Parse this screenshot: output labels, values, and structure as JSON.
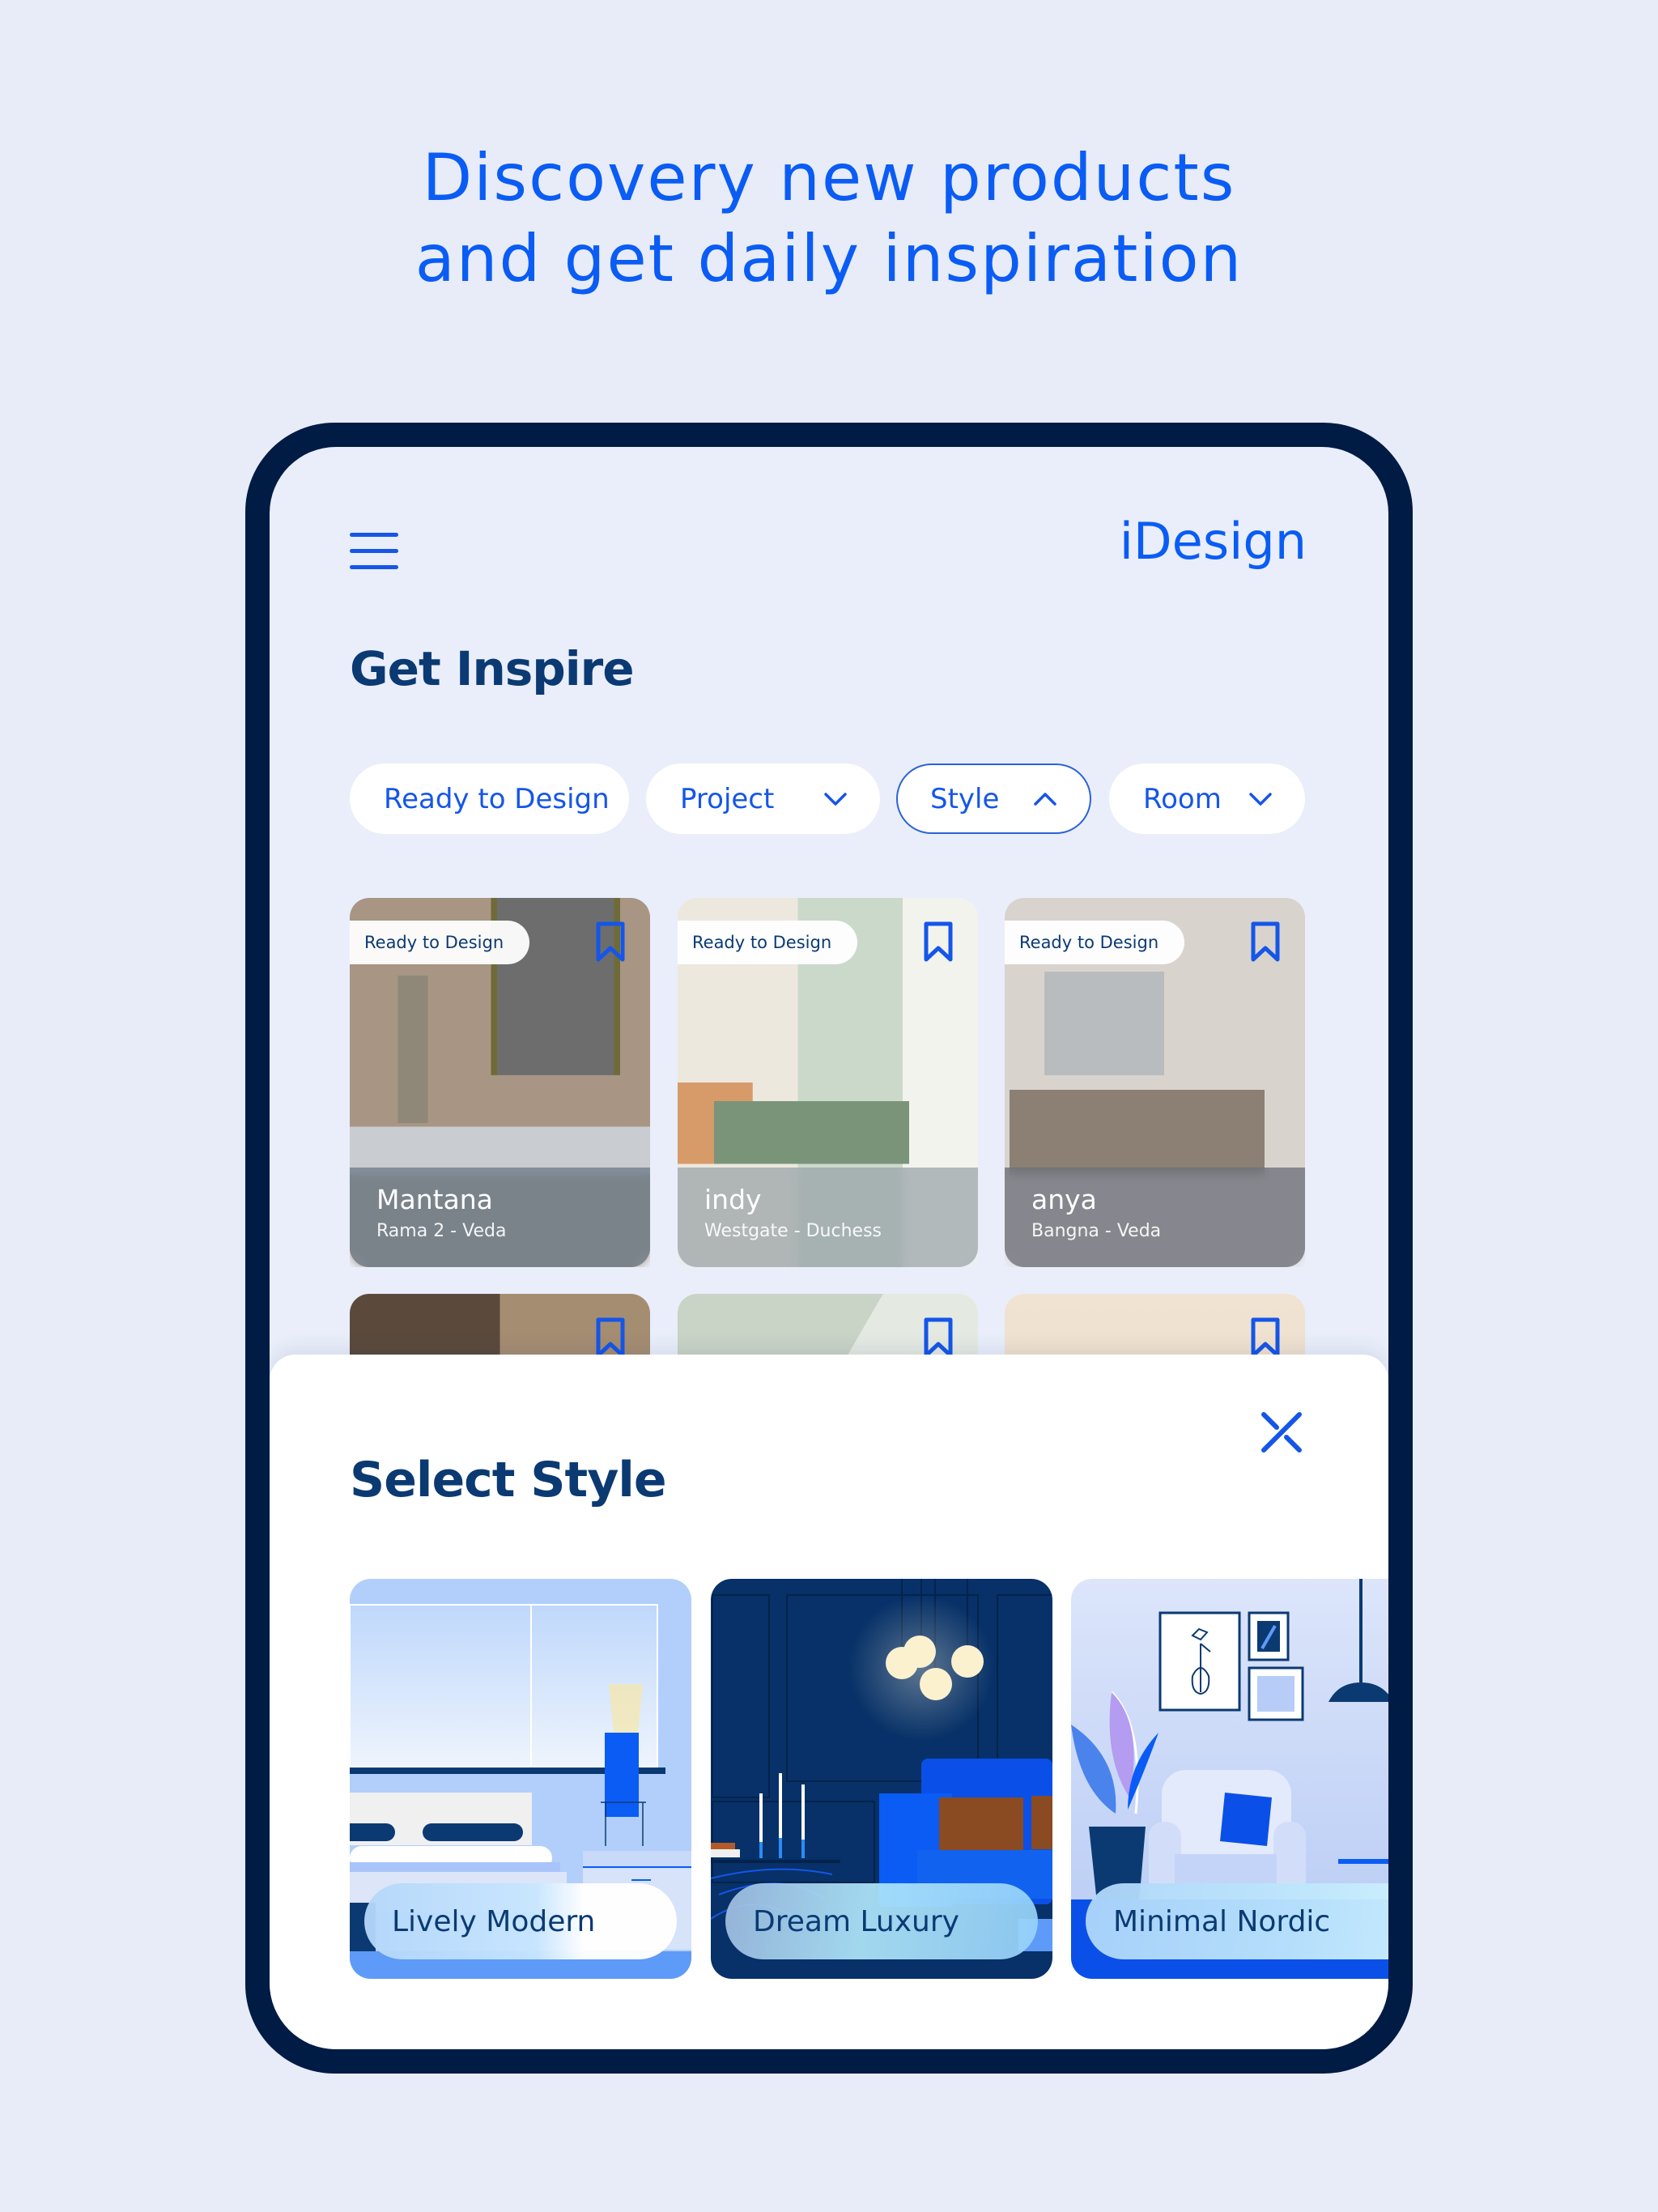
{
  "headline": {
    "line1": "Discovery new products",
    "line2": "and get daily inspiration"
  },
  "header": {
    "menu_icon": "hamburger-menu-icon",
    "logo": "iDesign"
  },
  "page_title": "Get Inspire",
  "filters": [
    {
      "label": "Ready to Design",
      "has_dropdown": false,
      "active": false
    },
    {
      "label": "Project",
      "has_dropdown": true,
      "expanded": false,
      "active": false
    },
    {
      "label": "Style",
      "has_dropdown": true,
      "expanded": true,
      "active": true
    },
    {
      "label": "Room",
      "has_dropdown": true,
      "expanded": false,
      "active": false
    }
  ],
  "designs": [
    {
      "badge": "Ready to Design",
      "name": "Mantana",
      "location": "Rama 2 - Veda",
      "bookmark_icon": "bookmark-icon"
    },
    {
      "badge": "Ready to Design",
      "name": "indy",
      "location": "Westgate - Duchess",
      "bookmark_icon": "bookmark-icon"
    },
    {
      "badge": "Ready to Design",
      "name": "anya",
      "location": "Bangna - Veda",
      "bookmark_icon": "bookmark-icon"
    }
  ],
  "designs_row2_count": 3,
  "style_sheet": {
    "title": "Select Style",
    "close_icon": "close-icon",
    "styles": [
      {
        "label": "Lively Modern"
      },
      {
        "label": "Dream Luxury"
      },
      {
        "label": "Minimal Nordic"
      }
    ]
  },
  "colors": {
    "brand_blue": "#0A5CF5",
    "navy": "#0B3A73",
    "frame": "#001B44",
    "page_bg": "#E8ECF8",
    "screen_bg": "#E9EEFA"
  }
}
